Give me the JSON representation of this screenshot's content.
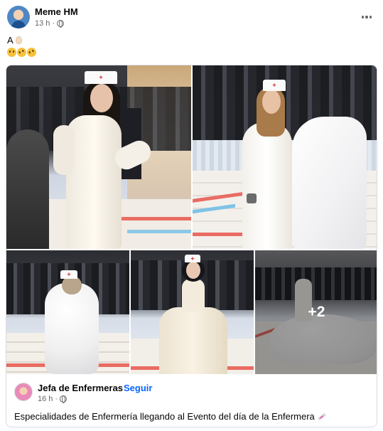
{
  "post": {
    "author": "Meme HM",
    "time": "13 h",
    "text": "A",
    "icons": {
      "more": "more-options-icon",
      "audience": "globe-icon",
      "reactions": [
        "astonished-face-emoji",
        "rofl-emoji",
        "rofl-emoji"
      ]
    }
  },
  "shared": {
    "page_name": "Jefa de Enfermeras",
    "separator": "·",
    "follow_label": "Seguir",
    "time": "16 h",
    "text": "Especialidades de Enfermería llegando al Evento del día de la Enfermera",
    "more_photos": "+2"
  },
  "colors": {
    "link": "#0866ff",
    "secondary_text": "#65676b",
    "border": "#d9dbdf"
  }
}
